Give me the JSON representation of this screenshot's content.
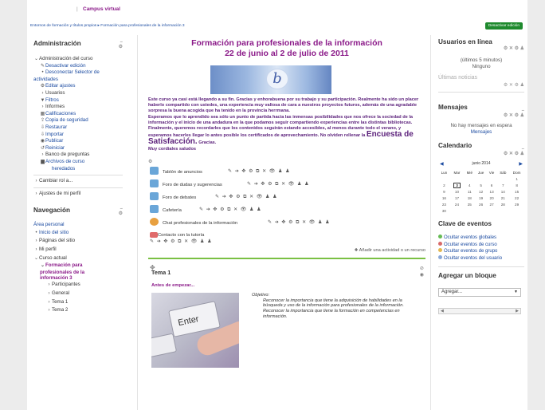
{
  "header": {
    "site_name": "Campus virtual",
    "breadcrumb": "Entornos de formación y títulos propios  ▸  Formación para profesionales de la información 3",
    "edit_button": "Desactivar edición"
  },
  "admin": {
    "title": "Administración",
    "items": [
      {
        "label": "Administración del curso",
        "icon": "chevron-down-icon"
      },
      {
        "label": "Desactivar edición",
        "icon": "pencil-icon"
      },
      {
        "label": "Desconectar Selector de actividades",
        "icon": "bullet-icon"
      },
      {
        "label": "Editar ajustes",
        "icon": "gear-icon"
      },
      {
        "label": "Usuarios",
        "icon": "chevron-right-icon"
      },
      {
        "label": "Filtros",
        "icon": "filter-icon"
      },
      {
        "label": "Informes",
        "icon": "chevron-right-icon"
      },
      {
        "label": "Calificaciones",
        "icon": "grades-icon"
      },
      {
        "label": "Copia de seguridad",
        "icon": "backup-icon"
      },
      {
        "label": "Restaurar",
        "icon": "restore-icon"
      },
      {
        "label": "Importar",
        "icon": "import-icon"
      },
      {
        "label": "Publicar",
        "icon": "publish-icon"
      },
      {
        "label": "Reiniciar",
        "icon": "reset-icon"
      },
      {
        "label": "Banco de preguntas",
        "icon": "chevron-right-icon"
      },
      {
        "label": "Archivos de curso heredados",
        "icon": "folder-icon"
      },
      {
        "label": "Cambiar rol a...",
        "icon": "chevron-right-icon"
      },
      {
        "label": "Ajustes de mi perfil",
        "icon": "chevron-right-icon"
      }
    ]
  },
  "navigation": {
    "title": "Navegación",
    "items": [
      "Área personal",
      "Inicio del sitio",
      "Páginas del sitio",
      "Mi perfil",
      "Curso actual",
      "Formación para profesionales de la información 3",
      "Participantes",
      "General",
      "Tema 1",
      "Tema 2"
    ]
  },
  "course": {
    "title": "Formación para profesionales de la información",
    "dates": "22 de junio al 2 de julio de 2011",
    "intro_p1": "Este curso ya casi está llegando a su fin. Gracias y enhorabuena por su trabajo y su participación. Realmente ha sido un placer haberlo compartido con ustedes, una experiencia muy valiosa de cara a nuestros proyectos futuros, además de una agradable sorpresa la buena acogida que ha tenido en la provincia herrmana.",
    "intro_p2": "Esperamos que lo aprendido sea sólo un punto de partida hacia las inmensas posibilidades que nos ofrece la sociedad de la información y el inicio de una andadura en la que podamos seguir compartiendo experiencias entre las distintas bibliotecas.",
    "intro_p3a": "Finalmente, queremos recordarles que los contenidos seguirán estando accesibles, al menos durante todo el verano, y esperamos hacerles llegar lo antes posible los certificados de aprovechamiento. No olviden rellenar la",
    "intro_big": "Encuesta de Satisfacción.",
    "intro_p3b": "Gracias.",
    "intro_p4": "Muy cordiales saludos",
    "banner_letter": "b",
    "activities": [
      {
        "name": "Tablón de anuncios",
        "color": "#6aa6d8"
      },
      {
        "name": "Foro de dudas y sugerencias",
        "color": "#6aa6d8"
      },
      {
        "name": "Foro de debates",
        "color": "#6aa6d8"
      },
      {
        "name": "Cafetería",
        "color": "#6aa6d8"
      },
      {
        "name": "Chat profesionales de la información",
        "color": "#e8a040"
      }
    ],
    "tools_glyphs": "✎ ➔ ✥ ⚙ ⧉ ✕ 👁 ♟ ♟",
    "mail_label": "Contacto con la tutoría",
    "add_activity": "✚ Añadir una actividad o un recurso",
    "section_title": "Tema 1",
    "section_sub": "Antes de empezar...",
    "objective_title": "Objetivo:",
    "objective_1": "Reconocer la importancia que tiene la adquisición de habilidades en la búsqueda y uso de la información para profesionales de la información.",
    "objective_2": "Reconocer la importancia que tiene la formación en competencias en información.",
    "key_label": "Enter"
  },
  "online": {
    "title": "Usuarios en línea",
    "subtitle": "(últimos 5 minutos)",
    "value": "Ninguno"
  },
  "news": {
    "title": "Últimas noticias"
  },
  "messages": {
    "title": "Mensajes",
    "text": "No hay mensajes en espera",
    "link": "Mensajes"
  },
  "calendar": {
    "title": "Calendario",
    "month": "junio 2014",
    "days": [
      "Lun",
      "Mar",
      "Mié",
      "Jue",
      "Vie",
      "Sáb",
      "Dom"
    ],
    "weeks": [
      [
        "",
        "",
        "",
        "",
        "",
        "",
        "1"
      ],
      [
        "2",
        "3",
        "4",
        "5",
        "6",
        "7",
        "8"
      ],
      [
        "9",
        "10",
        "11",
        "12",
        "13",
        "14",
        "15"
      ],
      [
        "16",
        "17",
        "18",
        "19",
        "20",
        "21",
        "22"
      ],
      [
        "23",
        "24",
        "25",
        "26",
        "27",
        "28",
        "29"
      ],
      [
        "30",
        "",
        "",
        "",
        "",
        "",
        ""
      ]
    ],
    "today": "3"
  },
  "events": {
    "title": "Clave de eventos",
    "items": [
      {
        "label": "Ocultar eventos globales",
        "color": "#66bb55"
      },
      {
        "label": "Ocultar eventos de curso",
        "color": "#d86a6a"
      },
      {
        "label": "Ocultar eventos de grupo",
        "color": "#e3b850"
      },
      {
        "label": "Ocultar eventos del usuario",
        "color": "#8aa8d8"
      }
    ]
  },
  "add_block": {
    "title": "Agregar un bloque",
    "select_value": "Agregar..."
  }
}
